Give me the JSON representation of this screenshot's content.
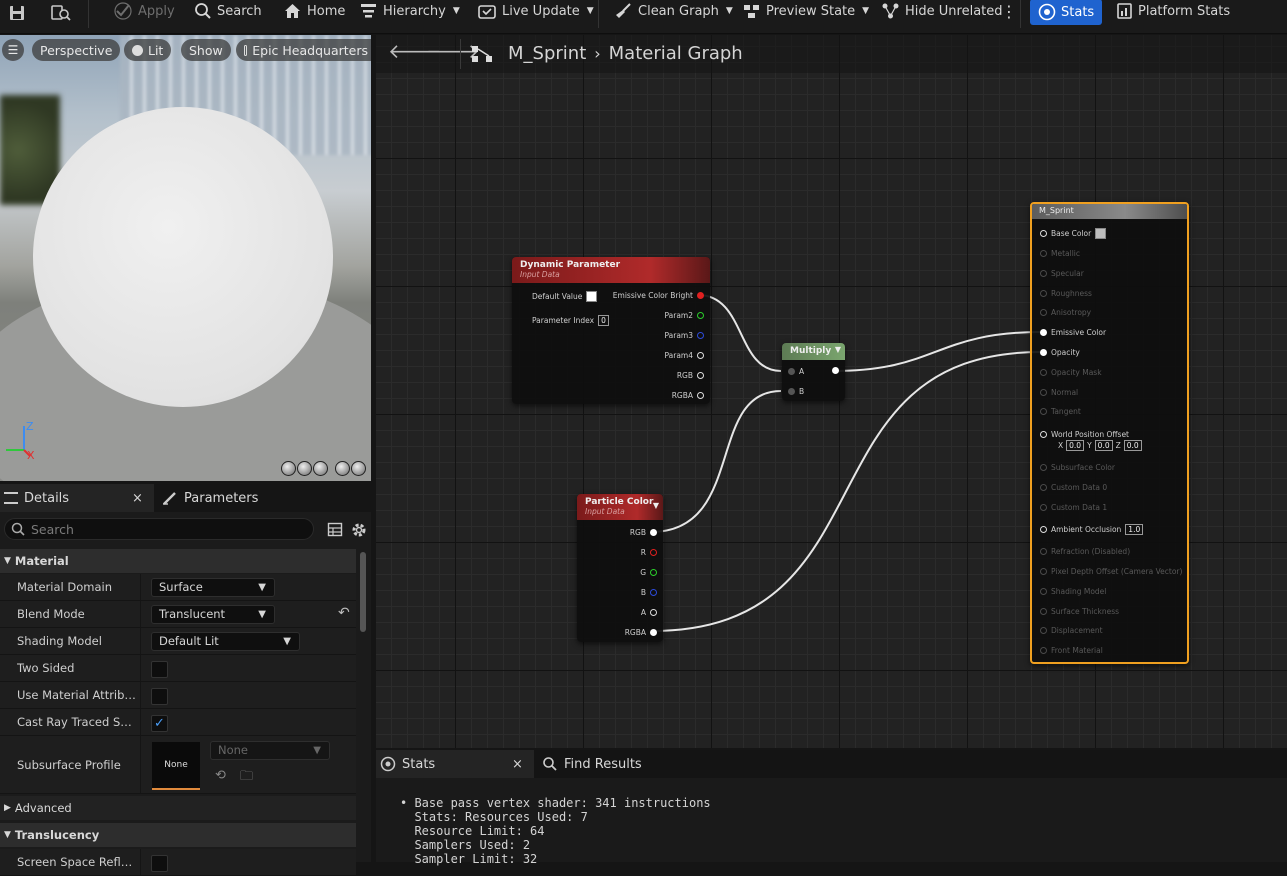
{
  "toolbar": {
    "apply": "Apply",
    "search": "Search",
    "home": "Home",
    "hierarchy": "Hierarchy",
    "live_update": "Live Update",
    "clean_graph": "Clean Graph",
    "preview_state": "Preview State",
    "hide_unrelated": "Hide Unrelated",
    "stats": "Stats",
    "platform_stats": "Platform Stats"
  },
  "viewport": {
    "perspective": "Perspective",
    "lit": "Lit",
    "show": "Show",
    "environment": "Epic Headquarters",
    "axis_z": "Z",
    "axis_x": "X"
  },
  "details": {
    "tab_details": "Details",
    "tab_parameters": "Parameters",
    "search_placeholder": "Search",
    "cat_material": "Material",
    "rows": {
      "material_domain": {
        "label": "Material Domain",
        "value": "Surface"
      },
      "blend_mode": {
        "label": "Blend Mode",
        "value": "Translucent"
      },
      "shading_model": {
        "label": "Shading Model",
        "value": "Default Lit"
      },
      "two_sided": {
        "label": "Two Sided"
      },
      "use_material_attributes": {
        "label": "Use Material Attributes"
      },
      "cast_ray_traced": {
        "label": "Cast Ray Traced Shad..."
      },
      "subsurface_profile": {
        "label": "Subsurface Profile",
        "thumb": "None",
        "value": "None"
      }
    },
    "cat_advanced": "Advanced",
    "cat_translucency": "Translucency",
    "trunc_row": "Screen Space Reflecti..."
  },
  "graph": {
    "crumb_asset": "M_Sprint",
    "crumb_view": "Material Graph",
    "dyn": {
      "title": "Dynamic Parameter",
      "sub": "Input Data",
      "default_value": "Default Value",
      "param_index": "Parameter Index",
      "param_index_value": "0",
      "out1": "Emissive Color Bright",
      "out2": "Param2",
      "out3": "Param3",
      "out4": "Param4",
      "out5": "RGB",
      "out6": "RGBA"
    },
    "mul": {
      "title": "Multiply",
      "a": "A",
      "b": "B"
    },
    "pc": {
      "title": "Particle Color",
      "sub": "Input Data",
      "rgb": "RGB",
      "r": "R",
      "g": "G",
      "b": "B",
      "a": "A",
      "rgba": "RGBA"
    },
    "res": {
      "title": "M_Sprint",
      "base_color": "Base Color",
      "metallic": "Metallic",
      "specular": "Specular",
      "roughness": "Roughness",
      "anisotropy": "Anisotropy",
      "emissive": "Emissive Color",
      "opacity": "Opacity",
      "opacity_mask": "Opacity Mask",
      "normal": "Normal",
      "tangent": "Tangent",
      "wpo": "World Position Offset",
      "wpo_x": "X",
      "wpo_y": "Y",
      "wpo_z": "Z",
      "wpo_xv": "0.0",
      "wpo_yv": "0.0",
      "wpo_zv": "0.0",
      "subsurface": "Subsurface Color",
      "cd0": "Custom Data 0",
      "cd1": "Custom Data 1",
      "ao": "Ambient Occlusion",
      "ao_v": "1.0",
      "refraction": "Refraction (Disabled)",
      "pdo": "Pixel Depth Offset (Camera Vector)",
      "shading": "Shading Model",
      "thickness": "Surface Thickness",
      "displacement": "Displacement",
      "front": "Front Material"
    }
  },
  "stats": {
    "tab_stats": "Stats",
    "tab_find": "Find Results",
    "text": "• Base pass vertex shader: 341 instructions\n  Stats: Resources Used: 7\n  Resource Limit: 64\n  Samplers Used: 2\n  Sampler Limit: 32"
  }
}
